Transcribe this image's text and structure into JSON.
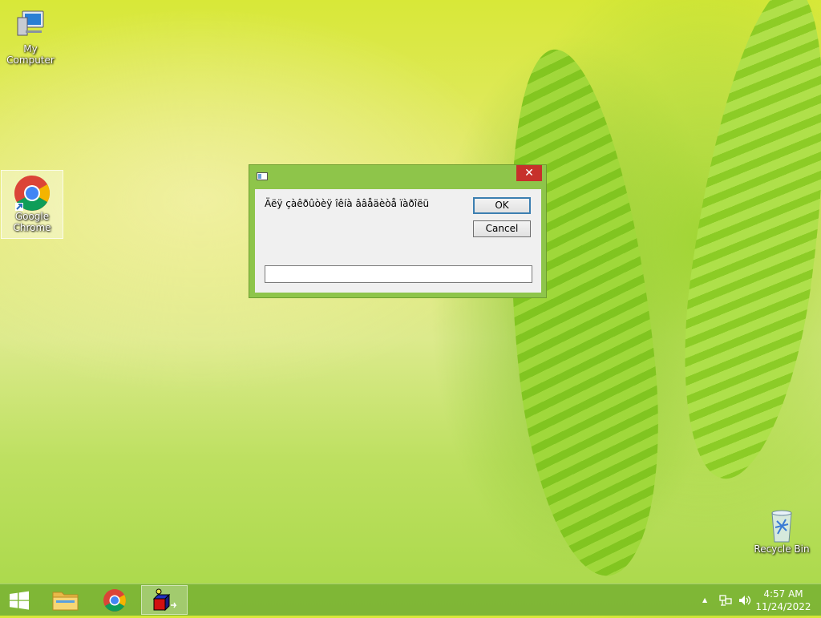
{
  "desktop": {
    "icons": [
      {
        "label": "My Computer",
        "icon": "computer-icon"
      },
      {
        "label": "Google\nChrome",
        "icon": "chrome-icon"
      },
      {
        "label": "Recycle Bin",
        "icon": "recycle-bin-icon"
      }
    ]
  },
  "dialog": {
    "title": "",
    "prompt": "Äëÿ çàêðûòèÿ îêíà ââåäèòå ïàðîëü",
    "ok_label": "OK",
    "cancel_label": "Cancel",
    "input_value": "",
    "close_glyph": "✕"
  },
  "taskbar": {
    "start_icon": "windows-logo-icon",
    "pinned": [
      {
        "name": "file-explorer",
        "icon": "folder-icon"
      },
      {
        "name": "chrome",
        "icon": "chrome-icon"
      },
      {
        "name": "running-app",
        "icon": "app-icon",
        "active": true
      }
    ],
    "tray": {
      "overflow_glyph": "▲",
      "time": "4:57 AM",
      "date": "11/24/2022"
    }
  },
  "colors": {
    "dialog_frame": "#8ec54a",
    "close_button": "#c7302b",
    "taskbar": "#7ab234"
  }
}
